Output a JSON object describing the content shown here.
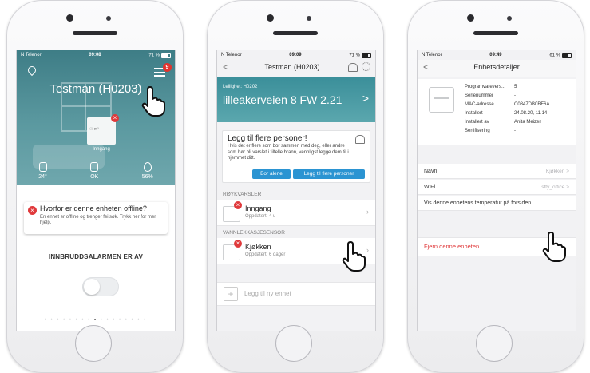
{
  "screen1": {
    "status": {
      "carrier": "N Telenor",
      "time": "09:08",
      "battery": "71 %"
    },
    "badge_count": "9",
    "title": "Testman (H0203)",
    "device_label": "Inngang",
    "device_small": "☉ m²",
    "stats": [
      {
        "value": "24°",
        "icon": "thermometer-icon"
      },
      {
        "value": "OK",
        "icon": "battery-icon"
      },
      {
        "value": "56%",
        "icon": "droplet-icon"
      }
    ],
    "warning": {
      "title": "Hvorfor er denne enheten offline?",
      "subtitle": "En enhet er offline og trenger feilsøk. Trykk her for mer hjelp."
    },
    "alarm_status": "INNBRUDDSALARMEN ER AV",
    "page_dots": {
      "before": "• • • • • • • •",
      "active": "•",
      "after": "• • • • • • • •"
    }
  },
  "screen2": {
    "status": {
      "carrier": "N Telenor",
      "time": "09:09",
      "battery": "71 %"
    },
    "nav": {
      "back": "<",
      "title": "Testman (H0203)"
    },
    "banner": {
      "line1": "Leilighet: H0202",
      "line2": "lilleakerveien 8 FW 2.21",
      "chevron": ">"
    },
    "add_people": {
      "heading": "Legg til flere personer!",
      "text": "Hvis det er flere som bor sammen med deg, eller andre som bør bli varslet i tilfelle brann, vennligst legge dem til i hjemmet ditt.",
      "btn_alone": "Bor alene",
      "btn_add": "Legg til flere personer"
    },
    "sections": [
      {
        "header": "RØYKVARSLER",
        "item": {
          "name": "Inngang",
          "updated": "Oppdatert: 4 u"
        }
      },
      {
        "header": "VANNLEKKASJESENSOR",
        "item": {
          "name": "Kjøkken",
          "updated": "Oppdatert: 6 dager"
        }
      }
    ],
    "add_unit": "Legg til ny enhet"
  },
  "screen3": {
    "status": {
      "carrier": "N Telenor",
      "time": "09:49",
      "battery": "61 %"
    },
    "nav": {
      "back": "<",
      "title": "Enhetsdetaljer"
    },
    "details": [
      {
        "key": "Programvarevers...",
        "value": "5"
      },
      {
        "key": "Serienummer",
        "value": "-"
      },
      {
        "key": "MAC-adresse",
        "value": "C0847DB0BF6A"
      },
      {
        "key": "Installert",
        "value": "24.08.20, 11:14"
      },
      {
        "key": "Installert av",
        "value": "Anita Meizer"
      },
      {
        "key": "Sertifisering",
        "value": "-"
      }
    ],
    "name_label": "Navn",
    "name_value": "Kjøkken >",
    "wifi_label": "WiFi",
    "wifi_value": "sfty_office >",
    "show_temp": "Vis denne enhetens temperatur på forsiden",
    "remove": "Fjern denne enheten"
  },
  "colors": {
    "accent": "#2b94d2",
    "teal": "#3b8f9a",
    "danger": "#e0393b"
  }
}
